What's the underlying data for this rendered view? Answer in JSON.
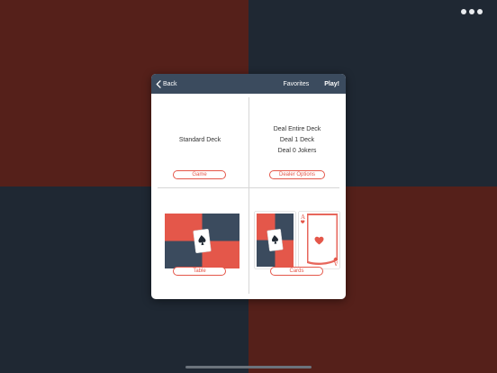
{
  "colors": {
    "nav_bg": "#3b4b5e",
    "accent": "#e4574a",
    "bg_red": "#55201a",
    "bg_navy": "#1f2833"
  },
  "toolbar": {
    "more_icon": "more-horizontal-icon"
  },
  "nav": {
    "back_label": "Back",
    "favorites_label": "Favorites",
    "play_label": "Play!"
  },
  "game": {
    "deck_name": "Standard Deck",
    "button_label": "Game"
  },
  "dealer": {
    "lines": [
      "Deal Entire Deck",
      "Deal 1 Deck",
      "Deal 0 Jokers"
    ],
    "button_label": "Dealer Options"
  },
  "table": {
    "button_label": "Table"
  },
  "cards": {
    "button_label": "Cards",
    "preview_rank": "A"
  }
}
